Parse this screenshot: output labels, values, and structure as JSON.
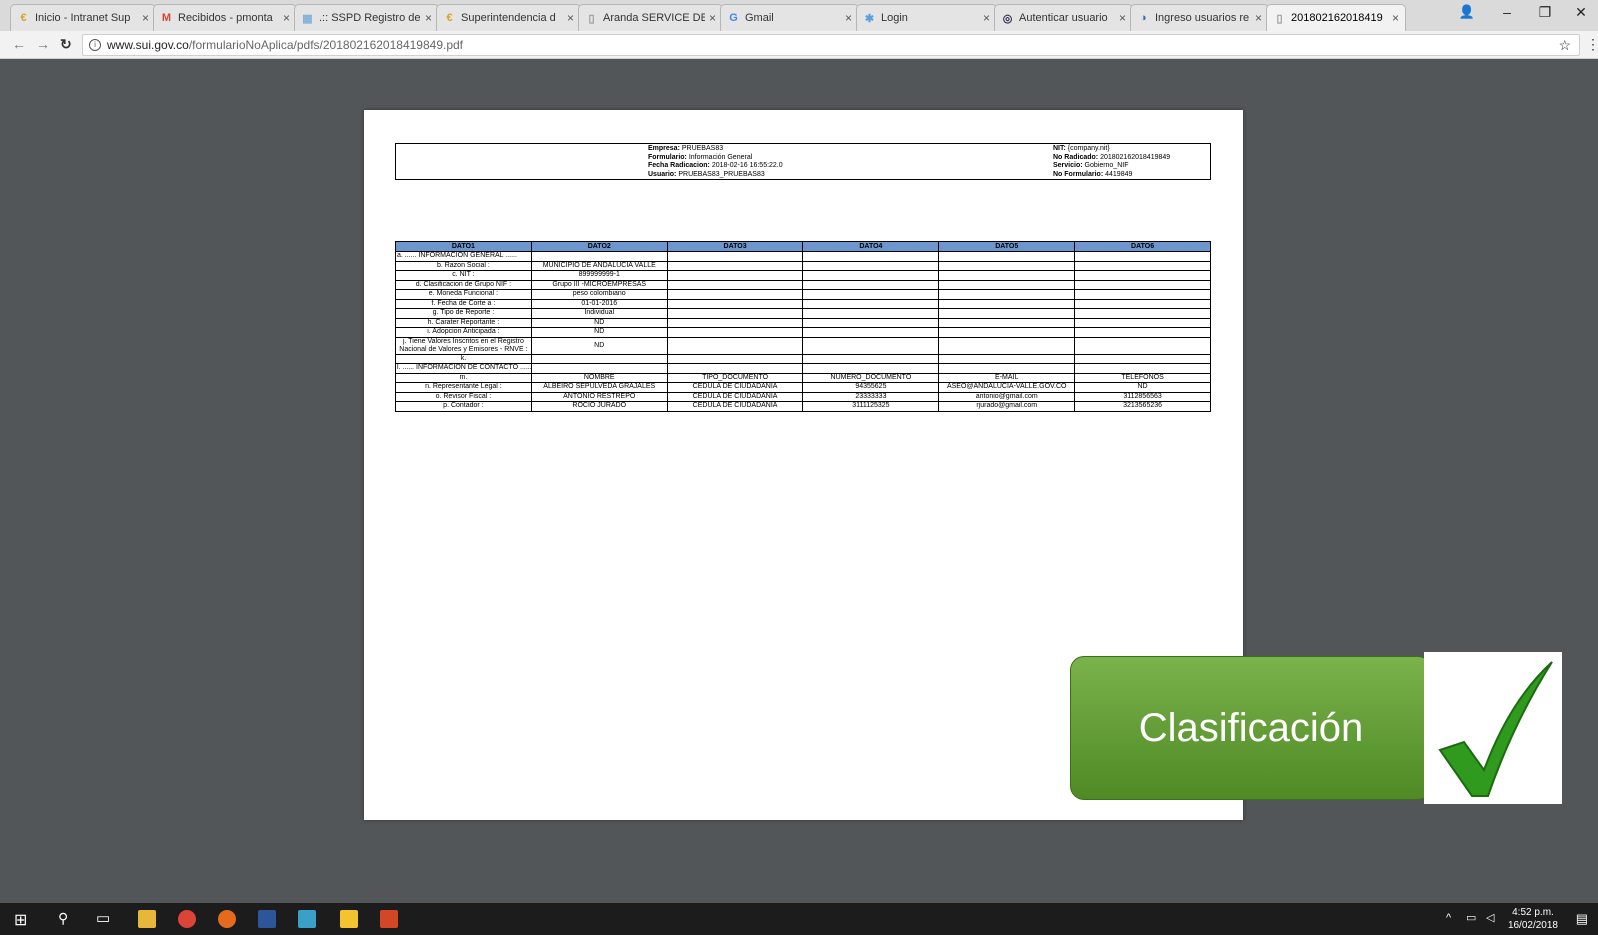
{
  "browser": {
    "tabs": [
      {
        "label": "Inicio - Intranet Sup",
        "close": "×"
      },
      {
        "label": "Recibidos - pmonta",
        "close": "×"
      },
      {
        "label": ".:: SSPD Registro de",
        "close": "×"
      },
      {
        "label": "Superintendencia d",
        "close": "×"
      },
      {
        "label": "Aranda SERVICE DE",
        "close": "×"
      },
      {
        "label": "Gmail",
        "close": "×"
      },
      {
        "label": "Login",
        "close": "×"
      },
      {
        "label": "Autenticar usuario",
        "close": "×"
      },
      {
        "label": "Ingreso usuarios re",
        "close": "×"
      },
      {
        "label": "201802162018419",
        "close": "×"
      }
    ],
    "url_host": "www.sui.gov.co",
    "url_path": "/formularioNoAplica/pdfs/201802162018419849.pdf",
    "window_controls": {
      "minimize": "–",
      "restore": "❐",
      "close": "✕"
    }
  },
  "pdf": {
    "header_left": {
      "empresa_label": "Empresa:",
      "empresa": "PRUEBAS83",
      "formulario_label": "Formulario:",
      "formulario": "Información General",
      "fecha_label": "Fecha Radicacion:",
      "fecha": "2018-02-16 16:55:22.0",
      "usuario_label": "Usuario:",
      "usuario": "PRUEBAS83_PRUEBAS83"
    },
    "header_right": {
      "nit_label": "NIT:",
      "nit": "{company.nit}",
      "radicado_label": "No Radicado:",
      "radicado": "201802162018419849",
      "servicio_label": "Servicio:",
      "servicio": "Gobierno_NIF",
      "formulario_label": "No Formulario:",
      "formulario": "4419849"
    },
    "table": {
      "headers": [
        "DATO1",
        "DATO2",
        "DATO3",
        "DATO4",
        "DATO5",
        "DATO6"
      ],
      "rows": [
        [
          "a. ...... INFORMACION GENERAL ......",
          "",
          "",
          "",
          "",
          ""
        ],
        [
          "b. Razon Social :",
          "MUNICIPIO DE ANDALUCIA VALLE",
          "",
          "",
          "",
          ""
        ],
        [
          "c. NIT :",
          "899999999-1",
          "",
          "",
          "",
          ""
        ],
        [
          "d. Clasificacion de Grupo NIF :",
          "Grupo III -MICROEMPRESAS",
          "",
          "",
          "",
          ""
        ],
        [
          "e. Moneda Funcional :",
          "peso colombiano",
          "",
          "",
          "",
          ""
        ],
        [
          "f. Fecha de Corte a :",
          "01-01-2016",
          "",
          "",
          "",
          ""
        ],
        [
          "g. Tipo de Reporte :",
          "Individual",
          "",
          "",
          "",
          ""
        ],
        [
          "h. Carater Reportante :",
          "ND",
          "",
          "",
          "",
          ""
        ],
        [
          "i. Adopcion Anticipada :",
          "ND",
          "",
          "",
          "",
          ""
        ],
        [
          "j. Tiene Valores Inscritos en el Registro Nacional de Valores y Emisores - RNVE :",
          "ND",
          "",
          "",
          "",
          ""
        ],
        [
          "k.",
          "",
          "",
          "",
          "",
          ""
        ],
        [
          "l. ...... INFORMACION DE CONTACTO ......",
          "",
          "",
          "",
          "",
          ""
        ],
        [
          "m.",
          "NOMBRE",
          "TIPO_DOCUMENTO",
          "NUMERO_DOCUMENTO",
          "E-MAIL",
          "TELEFONOS"
        ],
        [
          "n. Representante Legal :",
          "ALBEIRO SEPULVEDA GRAJALES",
          "CEDULA DE CIUDADANIA",
          "94355625",
          "ASEO@ANDALUCIA-VALLE.GOV.CO",
          "ND"
        ],
        [
          "o. Revisor Fiscal :",
          "ANTONIO RESTREPO",
          "CEDULA DE CIUDADANIA",
          "23333333",
          "antonio@gmail.com",
          "3112856563"
        ],
        [
          "p. Contador :",
          "ROCIO JURADO",
          "CEDULA DE CIUDADANIA",
          "3111125325",
          "rjurado@gmail.com",
          "3213565236"
        ]
      ]
    }
  },
  "overlay": {
    "label": "Clasificación",
    "accent": "#5f9b32"
  },
  "taskbar": {
    "time": "4:52 p.m.",
    "date": "16/02/2018"
  }
}
